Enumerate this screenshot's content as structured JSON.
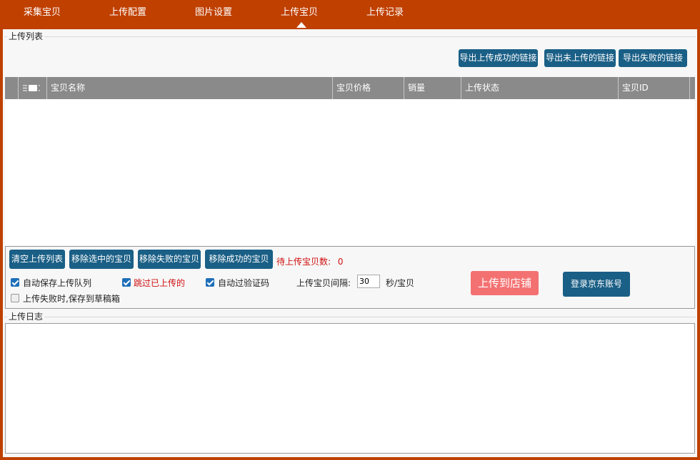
{
  "nav": {
    "tabs": [
      {
        "label": "采集宝贝"
      },
      {
        "label": "上传配置"
      },
      {
        "label": "图片设置"
      },
      {
        "label": "上传宝贝",
        "active": true
      },
      {
        "label": "上传记录"
      }
    ]
  },
  "upload_list": {
    "title": "上传列表",
    "export_success": "导出上传成功的链接",
    "export_not_uploaded": "导出未上传的链接",
    "export_failed": "导出失败的链接",
    "columns": [
      "宝贝名称",
      "宝贝价格",
      "销量",
      "上传状态",
      "宝贝ID"
    ],
    "rows": []
  },
  "controls": {
    "clear_list": "清空上传列表",
    "remove_selected": "移除选中的宝贝",
    "remove_failed": "移除失败的宝贝",
    "remove_success": "移除成功的宝贝",
    "pending_label": "待上传宝贝数:",
    "pending_count": "0",
    "auto_save_queue": {
      "label": "自动保存上传队列",
      "checked": true
    },
    "skip_uploaded": {
      "label": "跳过已上传的",
      "checked": true
    },
    "auto_captcha": {
      "label": "自动过验证码",
      "checked": true
    },
    "save_draft_on_fail": {
      "label": "上传失败时,保存到草稿箱",
      "checked": false
    },
    "interval_label": "上传宝贝间隔:",
    "interval_value": "30",
    "interval_unit": "秒/宝贝",
    "upload_button": "上传到店铺",
    "login_button": "登录京东账号"
  },
  "log": {
    "title": "上传日志"
  },
  "colors": {
    "frame": "#c04000",
    "button": "#1a5f86",
    "upload_button": "#f47171",
    "warning_text": "#d01010"
  }
}
